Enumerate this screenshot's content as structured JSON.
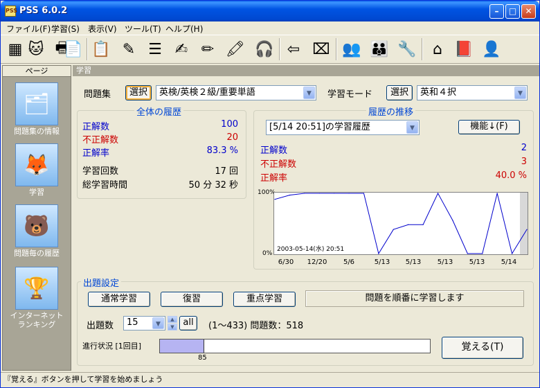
{
  "window": {
    "title": "PSS 6.0.2",
    "app_icon_text": "PSS",
    "minimize": "–",
    "maximize": "□",
    "close": "✕"
  },
  "menu": [
    {
      "label": "ファイル(F)"
    },
    {
      "label": "学習(S)"
    },
    {
      "label": "表示(V)"
    },
    {
      "label": "ツール(T)"
    },
    {
      "label": "ヘルプ(H)"
    }
  ],
  "toolbar_icons": [
    "grid-icon",
    "cat-icon",
    "printer-icon",
    "document-icon",
    "clipboard-icon",
    "pencil-list-icon",
    "red-list-icon",
    "pen-write-icon",
    "pencil-red-icon",
    "marker-icon",
    "headphone-cat-icon",
    "arrow-left-icon",
    "delete-icon",
    "users-icon",
    "family-icon",
    "tools-icon",
    "home-icon",
    "book-icon",
    "person-icon"
  ],
  "left_pane": {
    "header": "ページ",
    "items": [
      {
        "label": "問題集の情報",
        "icon": "info-documents-icon"
      },
      {
        "label": "学習",
        "icon": "fox-mascot-icon"
      },
      {
        "label": "問題毎の履歴",
        "icon": "bear-teacher-icon"
      },
      {
        "label": "インターネットランキング",
        "label_line1": "インターネット",
        "label_line2": "ランキング",
        "icon": "winner-mascots-icon"
      }
    ]
  },
  "main": {
    "header": "学習",
    "problem_set": {
      "label": "問題集",
      "select_button": "選択",
      "value": "英検/英検２級/重要単語"
    },
    "learning_mode": {
      "label": "学習モード",
      "select_button": "選択",
      "value": "英和４択"
    },
    "overall": {
      "title": "全体の履歴",
      "correct_label": "正解数",
      "correct_value": "100",
      "incorrect_label": "不正解数",
      "incorrect_value": "20",
      "rate_label": "正解率",
      "rate_value": "83.3 %",
      "sessions_label": "学習回数",
      "sessions_value": "17 回",
      "time_label": "総学習時間",
      "time_value": "50 分 32 秒"
    },
    "history": {
      "title": "履歴の推移",
      "session_select": "[5/14 20:51]の学習履歴",
      "function_button": "機能↓(F)",
      "correct_label": "正解数",
      "correct_value": "2",
      "incorrect_label": "不正解数",
      "incorrect_value": "3",
      "rate_label": "正解率",
      "rate_value": "40.0 %"
    },
    "settings": {
      "title": "出題設定",
      "normal_button": "通常学習",
      "review_button": "復習",
      "focus_button": "重点学習",
      "mode_description": "問題を順番に学習します",
      "count_label": "出題数",
      "count_value": "15",
      "all_button": "all",
      "range_text": "(1〜433) 問題数：518",
      "progress_label": "進行状況 [1回目]",
      "progress_value": 85,
      "progress_max": 518,
      "progress_text": "85",
      "memorize_button": "覚える(T)"
    }
  },
  "status_text": "『覚える』ボタンを押して学習を始めましょう",
  "chart_data": {
    "type": "line",
    "annotation": "2003-05-14(水) 20:51",
    "y_ticks": [
      "100%",
      "0%"
    ],
    "ylim": [
      0,
      100
    ],
    "x_tick_labels": [
      "6/30",
      "12/20",
      "5/6",
      "5/13",
      "5/13",
      "5/13",
      "5/13",
      "5/14"
    ],
    "series": [
      {
        "values": [
          90,
          97,
          100,
          100,
          100,
          100,
          100,
          0,
          40,
          48,
          48,
          100,
          55,
          0,
          0,
          100,
          0,
          40
        ]
      }
    ],
    "line_color": "#0000CC"
  }
}
